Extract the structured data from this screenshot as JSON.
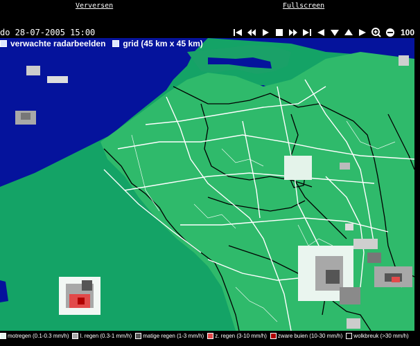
{
  "toplinks": {
    "refresh": "Verversen",
    "fullscreen": "Fullscreen"
  },
  "timestamp": "do 28-07-2005 15:00",
  "controls": [
    {
      "name": "first-frame-icon"
    },
    {
      "name": "rewind-icon"
    },
    {
      "name": "play-icon"
    },
    {
      "name": "stop-icon"
    },
    {
      "name": "fast-forward-icon"
    },
    {
      "name": "last-frame-icon"
    },
    {
      "name": "pan-left-icon"
    },
    {
      "name": "pan-down-icon"
    },
    {
      "name": "pan-up-icon"
    },
    {
      "name": "pan-right-icon"
    },
    {
      "name": "zoom-in-icon"
    },
    {
      "name": "zoom-out-icon"
    }
  ],
  "zoom_level": "100",
  "layers": {
    "forecast": "verwachte radarbeelden",
    "grid": "grid (45 km x 45 km)"
  },
  "legend": [
    {
      "label": "motregen (0.1-0.3 mm/h)",
      "color": "#e6f4ee"
    },
    {
      "label": "l. regen (0.3-1 mm/h)",
      "color": "#a8a8a8"
    },
    {
      "label": "matige regen (1-3 mm/h)",
      "color": "#555555"
    },
    {
      "label": "z. regen (3-10 mm/h)",
      "color": "#e24a4a"
    },
    {
      "label": "zware buien (10-30 mm/h)",
      "color": "#b00000"
    },
    {
      "label": "wolkbreuk (>30 mm/h)",
      "color": "#000000"
    }
  ],
  "colors": {
    "sea": "#05139c",
    "land": "#14a366",
    "land_light": "#2fba6b",
    "roads": "#ffffff",
    "borders": "#000000"
  }
}
